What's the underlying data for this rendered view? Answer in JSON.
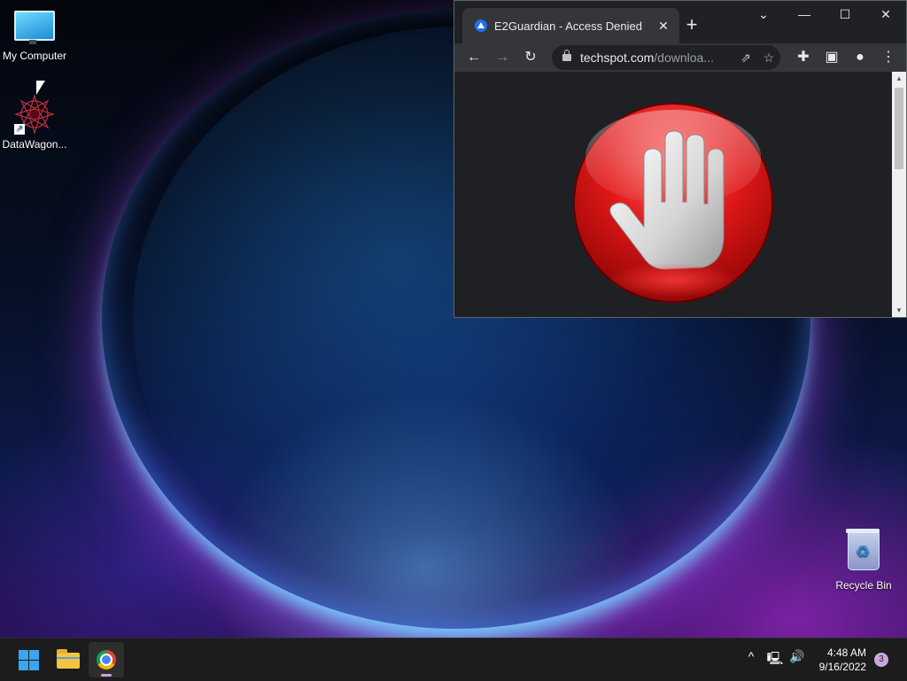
{
  "desktop": {
    "icons": [
      {
        "label": "My Computer",
        "icon": "computer-icon"
      },
      {
        "label": "DataWagon...",
        "icon": "datawagon-icon"
      },
      {
        "label": "Recycle Bin",
        "icon": "recycle-bin-icon"
      }
    ]
  },
  "browser": {
    "tab": {
      "title": "E2Guardian - Access Denied",
      "favicon": "e2guardian-icon"
    },
    "new_tab_symbol": "+",
    "window_controls": {
      "dropdown": "⌄",
      "minimize": "—",
      "maximize": "☐",
      "close": "✕"
    },
    "toolbar": {
      "back": "←",
      "forward": "→",
      "reload": "↻",
      "url_host": "techspot.com",
      "url_path": "/downloa...",
      "share": "⇗",
      "bookmark": "☆",
      "extensions": "✚",
      "sidepanel": "▣",
      "profile": "●",
      "menu": "⋮"
    },
    "content": {
      "image": "stop-hand-icon"
    }
  },
  "taskbar": {
    "items": [
      "start-button",
      "file-explorer",
      "chrome"
    ],
    "tray": {
      "chevron": "^",
      "network": "🖳",
      "volume": "🔊"
    },
    "clock": {
      "time": "4:48 AM",
      "date": "9/16/2022"
    },
    "notifications": "3"
  },
  "colors": {
    "accent": "#3aa6ef",
    "browser_bg": "#202124",
    "toolbar": "#35363a",
    "stop_red": "#e01818"
  }
}
